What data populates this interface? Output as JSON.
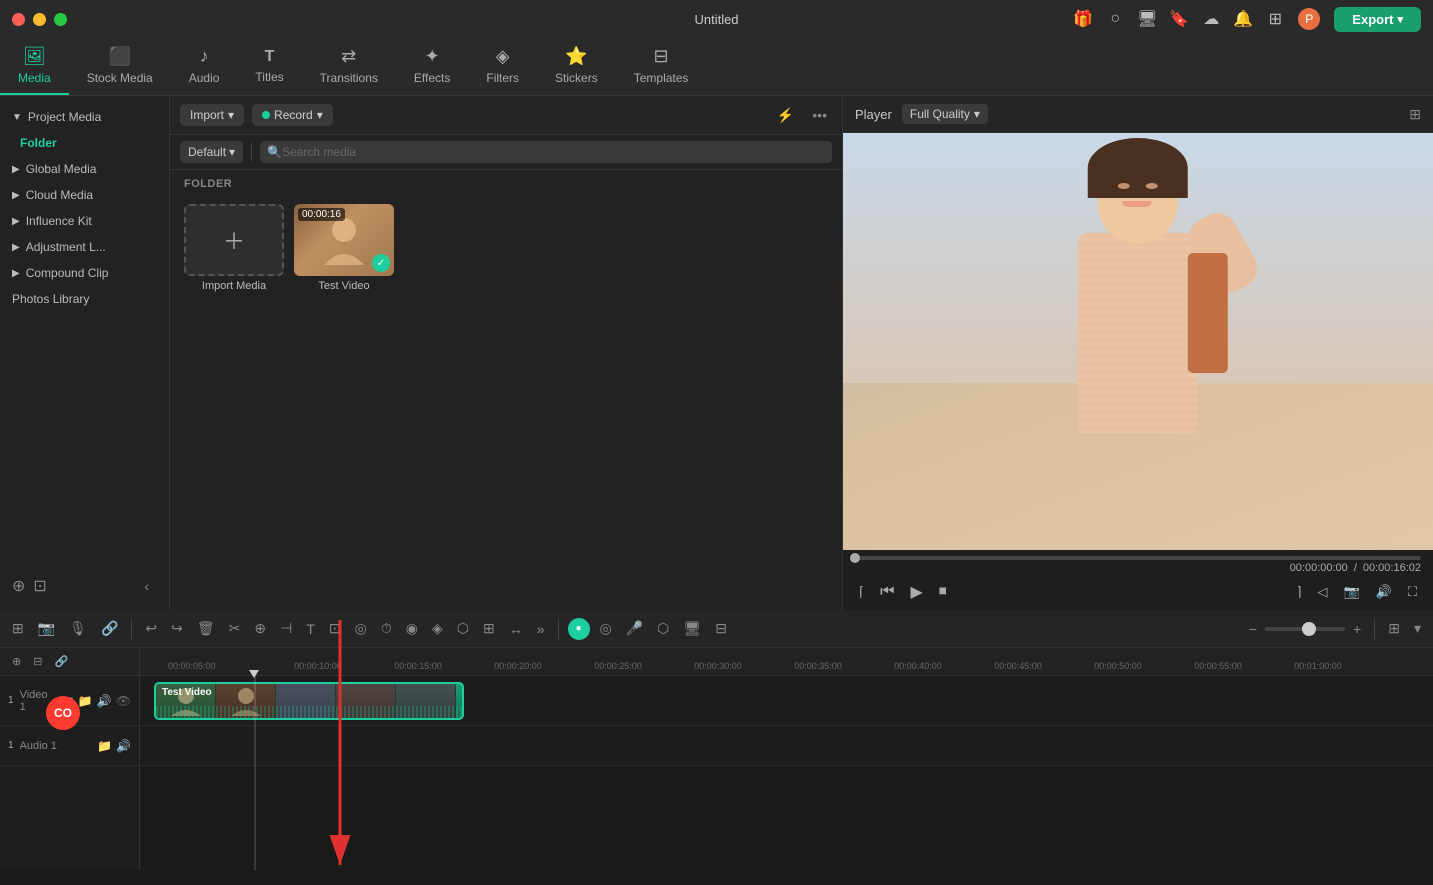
{
  "titlebar": {
    "title": "Untitled",
    "export_label": "Export",
    "traffic_lights": [
      "close",
      "minimize",
      "maximize"
    ]
  },
  "nav": {
    "tabs": [
      {
        "id": "media",
        "label": "Media",
        "icon": "🖼",
        "active": true
      },
      {
        "id": "stock",
        "label": "Stock Media",
        "icon": "🎬",
        "active": false
      },
      {
        "id": "audio",
        "label": "Audio",
        "icon": "🎵",
        "active": false
      },
      {
        "id": "titles",
        "label": "Titles",
        "icon": "T",
        "active": false
      },
      {
        "id": "transitions",
        "label": "Transitions",
        "icon": "↔",
        "active": false
      },
      {
        "id": "effects",
        "label": "Effects",
        "icon": "✨",
        "active": false
      },
      {
        "id": "filters",
        "label": "Filters",
        "icon": "🎨",
        "active": false
      },
      {
        "id": "stickers",
        "label": "Stickers",
        "icon": "⭐",
        "active": false
      },
      {
        "id": "templates",
        "label": "Templates",
        "icon": "⊞",
        "active": false
      }
    ]
  },
  "sidebar": {
    "project_media": "Project Media",
    "folder": "Folder",
    "items": [
      {
        "label": "Global Media",
        "chevron": "▶"
      },
      {
        "label": "Cloud Media",
        "chevron": "▶"
      },
      {
        "label": "Influence Kit",
        "chevron": "▶"
      },
      {
        "label": "Adjustment L...",
        "chevron": "▶"
      },
      {
        "label": "Compound Clip",
        "chevron": "▶"
      },
      {
        "label": "Photos Library",
        "chevron": ""
      }
    ]
  },
  "content": {
    "import_label": "Import",
    "record_label": "Record",
    "sort_label": "Default",
    "search_placeholder": "Search media",
    "folder_label": "FOLDER",
    "import_media_label": "Import Media",
    "video_label": "Test Video",
    "video_duration": "00:00:16"
  },
  "player": {
    "title": "Player",
    "quality": "Full Quality",
    "current_time": "00:00:00:00",
    "total_time": "00:00:16:02"
  },
  "timeline": {
    "ruler_marks": [
      "00:00:05:00",
      "00:00:10:00",
      "00:00:15:00",
      "00:00:20:00",
      "00:00:25:00",
      "00:00:30:00",
      "00:00:35:00",
      "00:00:40:00",
      "00:00:45:00",
      "00:00:50:00",
      "00:00:55:00",
      "00:01:00:00"
    ],
    "video_track_label": "Video 1",
    "audio_track_label": "Audio 1",
    "clip_label": "Test Video"
  },
  "co_badge": "CO",
  "icons": {
    "search": "🔍",
    "filter": "⚡",
    "more": "•••",
    "grid": "⊞"
  }
}
